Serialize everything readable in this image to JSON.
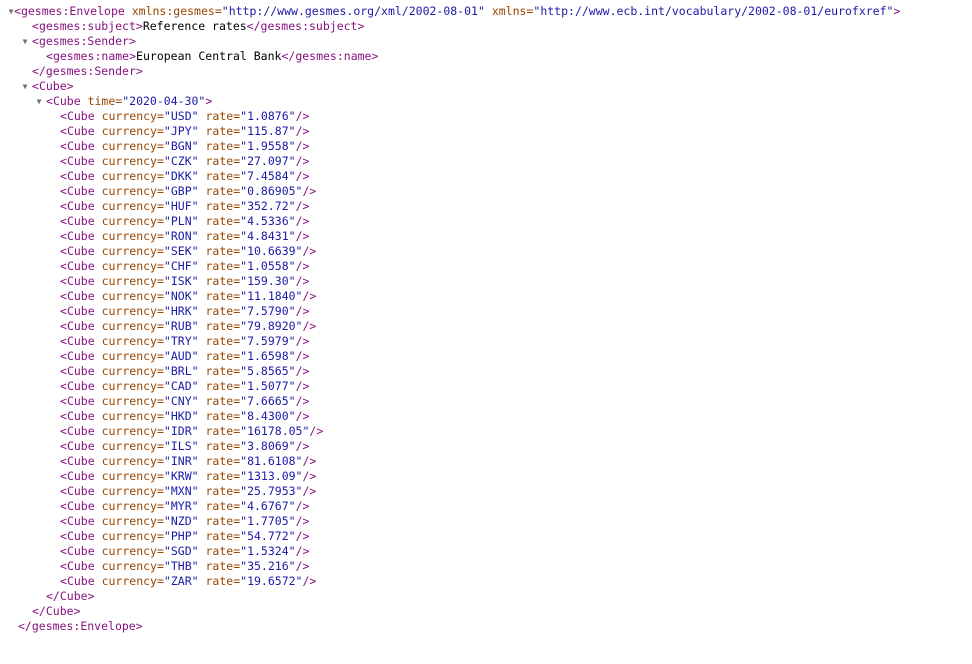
{
  "toggle_glyph": "▼",
  "envelope": {
    "tag": "gesmes:Envelope",
    "attrs": [
      {
        "name": "xmlns:gesmes",
        "value": "http://www.gesmes.org/xml/2002-08-01"
      },
      {
        "name": "xmlns",
        "value": "http://www.ecb.int/vocabulary/2002-08-01/eurofxref"
      }
    ]
  },
  "subject": {
    "tag": "gesmes:subject",
    "text": "Reference rates"
  },
  "sender": {
    "tag": "gesmes:Sender",
    "name": {
      "tag": "gesmes:name",
      "text": "European Central Bank"
    }
  },
  "cube": {
    "tag": "Cube",
    "time_attr": "time",
    "time": "2020-04-30",
    "currency_attr": "currency",
    "rate_attr": "rate",
    "rates": [
      {
        "currency": "USD",
        "rate": "1.0876"
      },
      {
        "currency": "JPY",
        "rate": "115.87"
      },
      {
        "currency": "BGN",
        "rate": "1.9558"
      },
      {
        "currency": "CZK",
        "rate": "27.097"
      },
      {
        "currency": "DKK",
        "rate": "7.4584"
      },
      {
        "currency": "GBP",
        "rate": "0.86905"
      },
      {
        "currency": "HUF",
        "rate": "352.72"
      },
      {
        "currency": "PLN",
        "rate": "4.5336"
      },
      {
        "currency": "RON",
        "rate": "4.8431"
      },
      {
        "currency": "SEK",
        "rate": "10.6639"
      },
      {
        "currency": "CHF",
        "rate": "1.0558"
      },
      {
        "currency": "ISK",
        "rate": "159.30"
      },
      {
        "currency": "NOK",
        "rate": "11.1840"
      },
      {
        "currency": "HRK",
        "rate": "7.5790"
      },
      {
        "currency": "RUB",
        "rate": "79.8920"
      },
      {
        "currency": "TRY",
        "rate": "7.5979"
      },
      {
        "currency": "AUD",
        "rate": "1.6598"
      },
      {
        "currency": "BRL",
        "rate": "5.8565"
      },
      {
        "currency": "CAD",
        "rate": "1.5077"
      },
      {
        "currency": "CNY",
        "rate": "7.6665"
      },
      {
        "currency": "HKD",
        "rate": "8.4300"
      },
      {
        "currency": "IDR",
        "rate": "16178.05"
      },
      {
        "currency": "ILS",
        "rate": "3.8069"
      },
      {
        "currency": "INR",
        "rate": "81.6108"
      },
      {
        "currency": "KRW",
        "rate": "1313.09"
      },
      {
        "currency": "MXN",
        "rate": "25.7953"
      },
      {
        "currency": "MYR",
        "rate": "4.6767"
      },
      {
        "currency": "NZD",
        "rate": "1.7705"
      },
      {
        "currency": "PHP",
        "rate": "54.772"
      },
      {
        "currency": "SGD",
        "rate": "1.5324"
      },
      {
        "currency": "THB",
        "rate": "35.216"
      },
      {
        "currency": "ZAR",
        "rate": "19.6572"
      }
    ]
  },
  "colors": {
    "tag": "#881280",
    "attribute": "#994500",
    "value": "#1a1aa6",
    "text": "#000000",
    "toggle": "#6e6e6e"
  }
}
